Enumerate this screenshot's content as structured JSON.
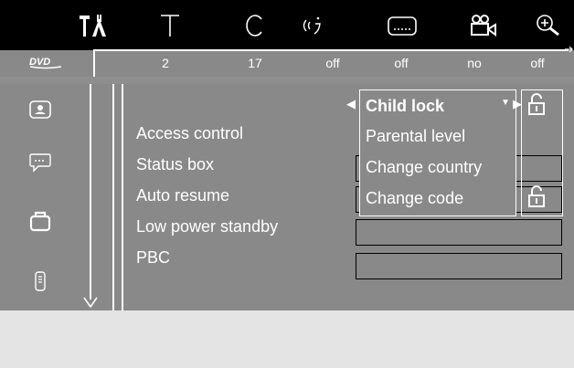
{
  "top_icons": [
    {
      "name": "settings-tools-icon"
    },
    {
      "name": "title-icon"
    },
    {
      "name": "chapter-icon"
    },
    {
      "name": "audio-icon"
    },
    {
      "name": "subtitle-icon"
    },
    {
      "name": "angle-camera-icon"
    },
    {
      "name": "zoom-icon"
    }
  ],
  "status": {
    "logo": "DVD",
    "values": [
      "2",
      "17",
      "off",
      "off",
      "no",
      "off"
    ]
  },
  "side_icons": [
    {
      "name": "picture-settings-icon"
    },
    {
      "name": "subtitle-settings-icon"
    },
    {
      "name": "features-bag-icon"
    },
    {
      "name": "remote-control-icon"
    }
  ],
  "menu": {
    "items": [
      {
        "label": "Access control"
      },
      {
        "label": "Status box"
      },
      {
        "label": "Auto resume"
      },
      {
        "label": "Low power standby"
      },
      {
        "label": "PBC"
      }
    ]
  },
  "submenu": {
    "items": [
      {
        "label": "Child lock",
        "selected": true
      },
      {
        "label": "Parental level",
        "selected": false
      },
      {
        "label": "Change country",
        "selected": false
      },
      {
        "label": "Change code",
        "selected": false
      }
    ],
    "arrow_left": "◀",
    "arrow_down": "▼",
    "arrow_right": "▶"
  },
  "lock_icons": [
    {
      "name": "unlocked-lock-icon"
    },
    {
      "name": "unlocked-lock-icon"
    }
  ],
  "colors": {
    "background": "#898989",
    "bar": "#000000",
    "text": "#ffffff",
    "bottom": "#e4e4e4"
  }
}
